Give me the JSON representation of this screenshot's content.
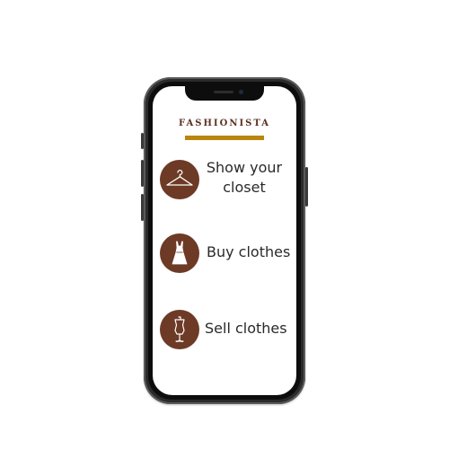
{
  "app": {
    "brand": "FASHIONISTA"
  },
  "menu": {
    "items": [
      {
        "id": "show-closet",
        "label": "Show your closet",
        "icon": "hanger-icon"
      },
      {
        "id": "buy-clothes",
        "label": "Buy clothes",
        "icon": "dress-icon"
      },
      {
        "id": "sell-clothes",
        "label": "Sell clothes",
        "icon": "mannequin-icon"
      }
    ]
  },
  "colors": {
    "brand_text": "#5e3222",
    "brand_bar": "#b8860b",
    "icon_circle": "#6d3a26",
    "label_text": "#2a2a2a",
    "phone_frame": "#2b2b2b"
  }
}
